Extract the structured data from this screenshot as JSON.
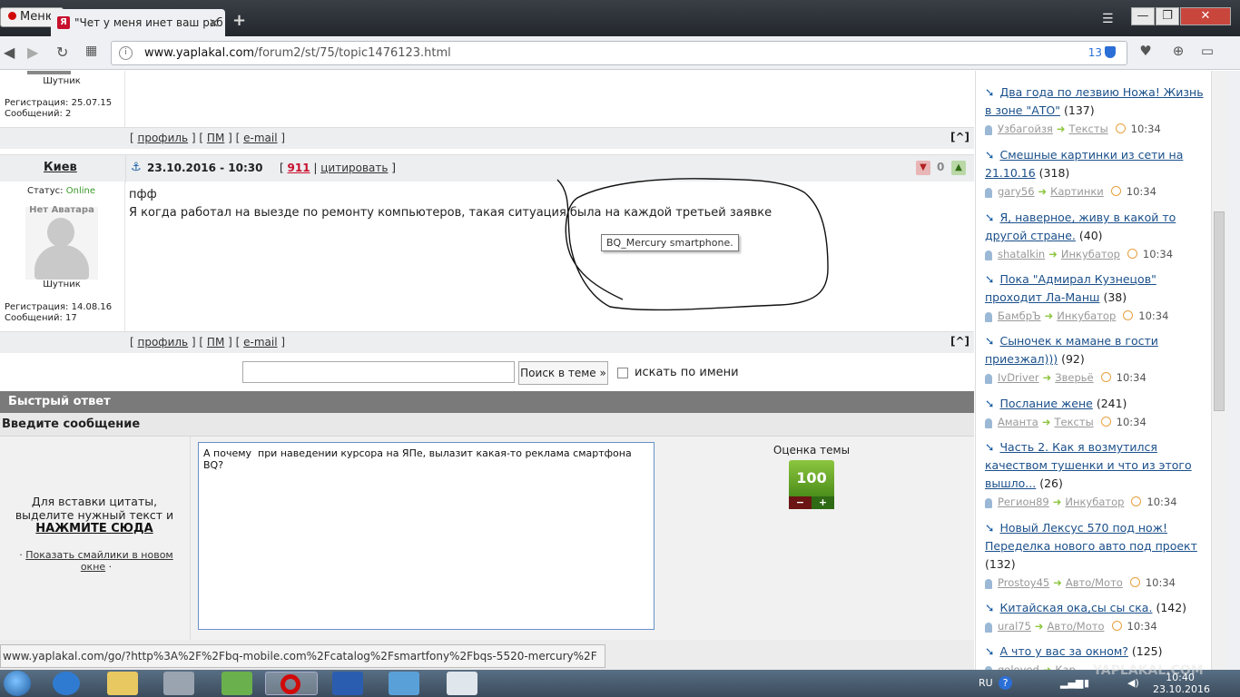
{
  "browser": {
    "menu_label": "Меню",
    "tab_title": "\"Чет у меня инет ваш раб",
    "tab_close": "×",
    "new_tab": "+",
    "url_domain": "www.yaplakal.com",
    "url_path": "/forum2/st/75/topic1476123.html",
    "adblock_count": "13",
    "window_minimize": "—",
    "window_maximize": "❐",
    "window_close": "✕"
  },
  "post1": {
    "rank": "Шутник",
    "reg": "Регистрация: 25.07.15",
    "msgs": "Сообщений: 2"
  },
  "post2": {
    "author": "Киев",
    "date": "23.10.2016 - 10:30",
    "num": "911",
    "quote": "цитировать",
    "votes": "0",
    "status_label": "Статус:",
    "status_value": "Online",
    "avatar_caption": "Нет Аватара",
    "rank": "Шутник",
    "reg": "Регистрация: 14.08.16",
    "msgs": "Сообщений: 17",
    "line1": "пфф",
    "line2": "Я когда работал на выезде по ремонту компьютеров, такая ситуация была на каждой третьей заявке"
  },
  "footer_links": {
    "profile": "профиль",
    "pm": "ПМ",
    "email": "e-mail",
    "up": "[^]"
  },
  "tooltip_text": "BQ_Mercury smartphone.",
  "search": {
    "button": "Поиск в теме »",
    "by_name": "искать по имени"
  },
  "quick_reply": {
    "header": "Быстрый ответ",
    "enter_msg": "Введите сообщение",
    "hint": "Для вставки цитаты, выделите нужный текст и",
    "click_here": "НАЖМИТЕ СЮДА",
    "smilies": "Показать смайлики в новом окне",
    "message_value": "А почему  при наведении курсора на ЯПе, вылазит какая-то реклама смартфона BQ?",
    "rating_label": "Оценка темы",
    "rating_value": "100",
    "minus": "−",
    "plus": "+"
  },
  "status_url": "www.yaplakal.com/go/?http%3A%2F%2Fbq-mobile.com%2Fcatalog%2Fsmartfony%2Fbqs-5520-mercury%2F",
  "sidebar": {
    "items": [
      {
        "title": "Два года по лезвию Ножа! Жизнь в зоне \"АТО\"",
        "count": "(137)",
        "user": "Узбагойзя",
        "section": "Тексты",
        "time": "10:34"
      },
      {
        "title": "Смешные картинки из сети на 21.10.16",
        "count": "(318)",
        "user": "gary56",
        "section": "Картинки",
        "time": "10:34"
      },
      {
        "title": "Я, наверное, живу в какой то другой стране.",
        "count": "(40)",
        "user": "shatalkin",
        "section": "Инкубатор",
        "time": "10:34"
      },
      {
        "title": "Пока \"Адмирал Кузнецов\" проходит Ла-Манш",
        "count": "(38)",
        "user": "БамбрЪ",
        "section": "Инкубатор",
        "time": "10:34"
      },
      {
        "title": "Сыночек к мамане в гости приезжал)))",
        "count": "(92)",
        "user": "IvDriver",
        "section": "Зверьё",
        "time": "10:34"
      },
      {
        "title": "Послание жене",
        "count": "(241)",
        "user": "Аманта",
        "section": "Тексты",
        "time": "10:34"
      },
      {
        "title": "Часть 2. Как я возмутился качеством тушенки и что из этого вышло...",
        "count": "(26)",
        "user": "Регион89",
        "section": "Инкубатор",
        "time": "10:34"
      },
      {
        "title": "Новый Лексус 570 под нож! Переделка нового авто под проект",
        "count": "(132)",
        "user": "Prostoy45",
        "section": "Авто/Мото",
        "time": "10:34"
      },
      {
        "title": "Китайская ока,сы сы ска.",
        "count": "(142)",
        "user": "ural75",
        "section": "Авто/Мото",
        "time": "10:34"
      },
      {
        "title": "А что у вас за окном?",
        "count": "(125)",
        "user": "goloved",
        "section": "Кар",
        "time": ""
      }
    ]
  },
  "taskbar": {
    "lang": "RU",
    "time": "10:40",
    "date": "23.10.2016",
    "watermark": "YAPLAKAL.COM"
  },
  "colors": {
    "link": "#1a4f8a",
    "post_number": "#c8102e",
    "online": "#3a9a2a",
    "quick_reply_bar": "#7a7a7a",
    "rating_green": "#6aaa2e"
  }
}
